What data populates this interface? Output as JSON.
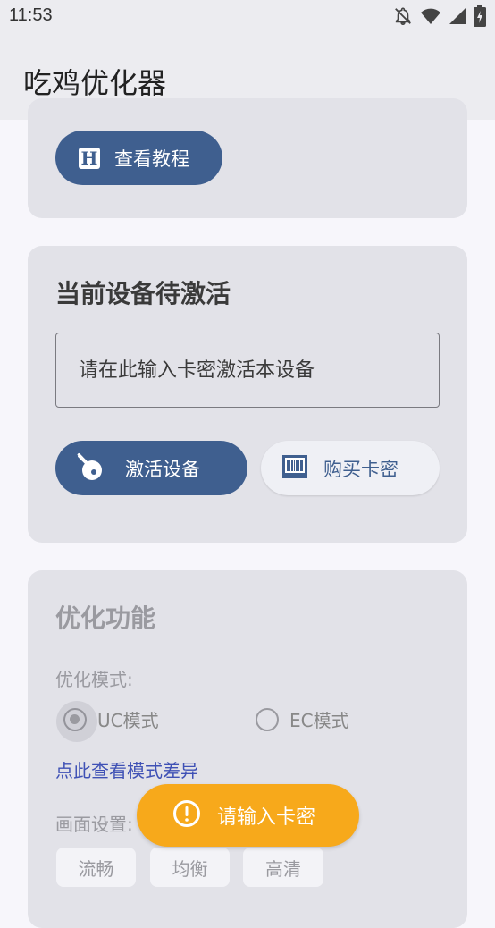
{
  "status_bar": {
    "time": "11:53",
    "icons": [
      "bell-off-icon",
      "wifi-icon",
      "signal-icon",
      "battery-icon"
    ]
  },
  "app_bar": {
    "title": "吃鸡优化器"
  },
  "tutorial_card": {
    "button_label": "查看教程",
    "button_icon": "h-icon"
  },
  "activation_card": {
    "title": "当前设备待激活",
    "input": {
      "placeholder": "请在此输入卡密激活本设备",
      "value": ""
    },
    "activate_button": {
      "label": "激活设备",
      "icon": "key-icon"
    },
    "buy_button": {
      "label": "购买卡密",
      "icon": "barcode-icon"
    }
  },
  "optimize_card": {
    "title": "优化功能",
    "mode_label": "优化模式:",
    "modes": [
      {
        "label": "UC模式",
        "selected": true
      },
      {
        "label": "EC模式",
        "selected": false
      }
    ],
    "diff_link": "点此查看模式差异",
    "quality_label": "画面设置:",
    "quality_options": [
      "流畅",
      "均衡",
      "高清"
    ]
  },
  "toast": {
    "message": "请输入卡密",
    "icon": "alert-circle-icon"
  },
  "colors": {
    "primary": "#3f5f8f",
    "card_bg": "#e2e2e8",
    "toast_bg": "#f7a91b",
    "link": "#3f51b5"
  }
}
